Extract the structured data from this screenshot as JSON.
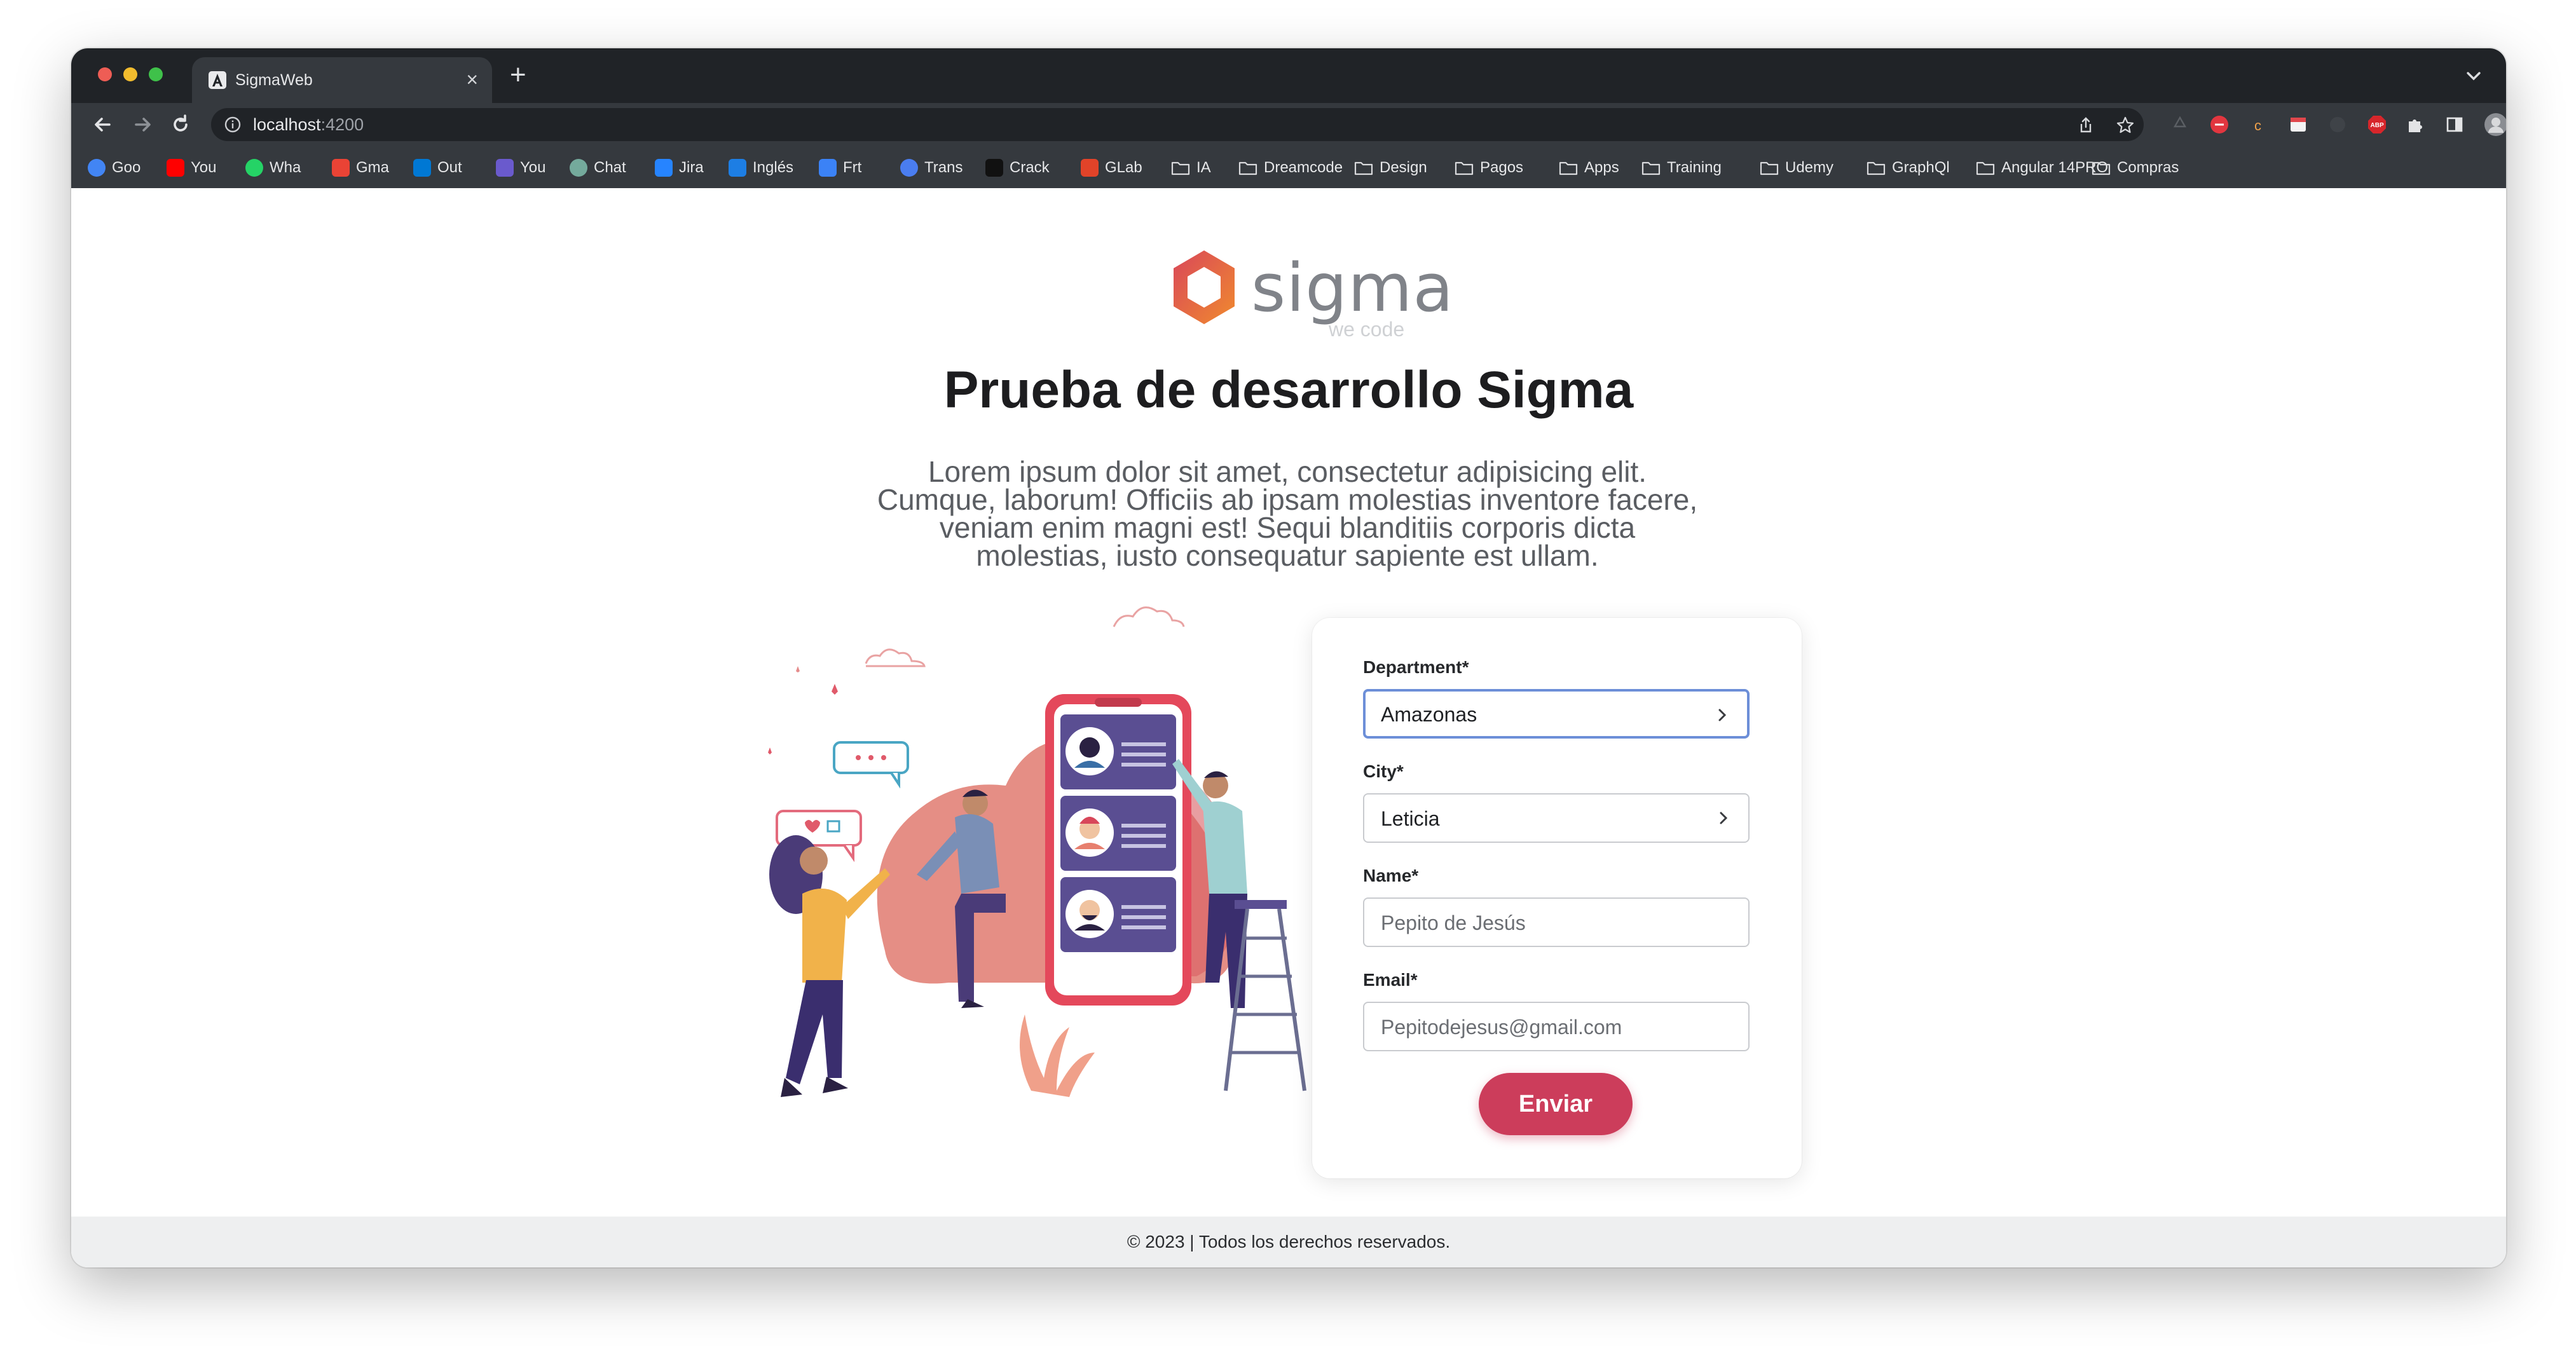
{
  "browser": {
    "tab": {
      "title": "SigmaWeb",
      "close": "×"
    },
    "new_tab": "+",
    "address": {
      "host": "localhost",
      "port": ":4200"
    },
    "bookmarks": [
      {
        "label": "Goo",
        "icon": "google-icon",
        "color": "#4285f4"
      },
      {
        "label": "You",
        "icon": "youtube-icon",
        "color": "#ff0000"
      },
      {
        "label": "Wha",
        "icon": "whatsapp-icon",
        "color": "#25d366"
      },
      {
        "label": "Gma",
        "icon": "gmail-icon",
        "color": "#ea4335"
      },
      {
        "label": "Out",
        "icon": "outlook-icon",
        "color": "#0078d4"
      },
      {
        "label": "You",
        "icon": "app-icon",
        "color": "#6a5acd"
      },
      {
        "label": "Chat",
        "icon": "chatgpt-icon",
        "color": "#74aa9c"
      },
      {
        "label": "Jira",
        "icon": "jira-icon",
        "color": "#2684ff"
      },
      {
        "label": "Inglés",
        "icon": "ef-icon",
        "color": "#1d7ee4"
      },
      {
        "label": "Frt",
        "icon": "check-icon",
        "color": "#3b82f6"
      },
      {
        "label": "Trans",
        "icon": "translate-icon",
        "color": "#4a7df0"
      },
      {
        "label": "Crack",
        "icon": "jc-icon",
        "color": "#111111"
      },
      {
        "label": "GLab",
        "icon": "gitlab-icon",
        "color": "#e24329"
      },
      {
        "label": "IA",
        "icon": "folder-icon"
      },
      {
        "label": "Dreamcode",
        "icon": "folder-icon"
      },
      {
        "label": "Design",
        "icon": "folder-icon"
      },
      {
        "label": "Pagos",
        "icon": "folder-icon"
      },
      {
        "label": "Apps",
        "icon": "folder-icon"
      },
      {
        "label": "Training",
        "icon": "folder-icon"
      },
      {
        "label": "Udemy",
        "icon": "folder-icon"
      },
      {
        "label": "GraphQl",
        "icon": "folder-icon"
      },
      {
        "label": "Angular 14PRO",
        "icon": "folder-icon"
      },
      {
        "label": "Compras",
        "icon": "folder-icon"
      }
    ]
  },
  "page": {
    "logo": {
      "name": "sigma",
      "tagline": "we code"
    },
    "title": "Prueba de desarrollo Sigma",
    "description": "Lorem ipsum dolor sit amet, consectetur adipisicing elit. Cumque, laborum! Officiis ab ipsam molestias inventore facere, veniam enim magni est! Sequi blanditiis corporis dicta molestias, iusto consequatur sapiente est ullam."
  },
  "form": {
    "department": {
      "label": "Department*",
      "value": "Amazonas"
    },
    "city": {
      "label": "City*",
      "value": "Leticia"
    },
    "name": {
      "label": "Name*",
      "placeholder": "Pepito de Jesús"
    },
    "email": {
      "label": "Email*",
      "placeholder": "Pepitodejesus@gmail.com"
    },
    "submit": "Enviar"
  },
  "footer": {
    "text": "© 2023 | Todos los derechos reservados."
  },
  "colors": {
    "brand": "#cc3d5b",
    "logo_orange": "#e8703a",
    "chrome_dark": "#202327",
    "chrome": "#35393e"
  }
}
